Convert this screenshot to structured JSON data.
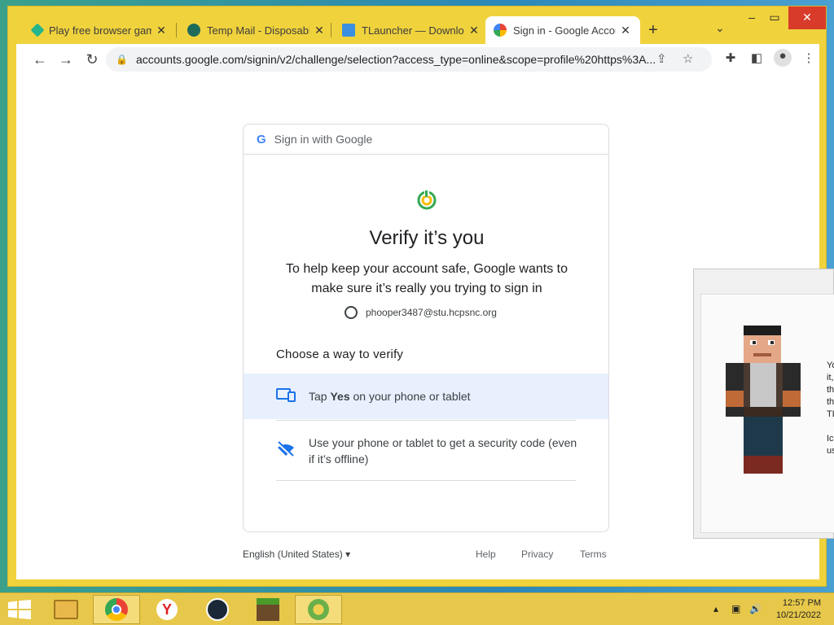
{
  "browser": {
    "tabs": [
      {
        "title": "Play free browser games",
        "favicon": "diamond-favicon",
        "color": "#23b58c"
      },
      {
        "title": "Temp Mail - Disposable",
        "favicon": "tempmail-favicon",
        "color": "#1f6b5a"
      },
      {
        "title": "TLauncher — Download",
        "favicon": "tlauncher-favicon",
        "color": "#3b8fe0"
      },
      {
        "title": "Sign in - Google Account",
        "favicon": "google-favicon",
        "color": "#4285f4"
      }
    ],
    "url": "accounts.google.com/signin/v2/challenge/selection?access_type=online&scope=profile%20https%3A..."
  },
  "page": {
    "header": "Sign in with Google",
    "title": "Verify it’s you",
    "subtitle": "To help keep your account safe, Google wants to make sure it’s really you trying to sign in",
    "account_email": "phooper3487@stu.hcpsnc.org",
    "choose_heading": "Choose a way to verify",
    "options": [
      {
        "prefix": "Tap ",
        "bold": "Yes",
        "suffix": " on your phone or tablet"
      },
      {
        "text": "Use your phone or tablet to get a security code (even if it’s offline)"
      }
    ],
    "footer": {
      "language": "English (United States)",
      "help": "Help",
      "privacy": "Privacy",
      "terms": "Terms"
    }
  },
  "side_window": {
    "text": "You\nit, y\nthe\nthe\nTLa\n\nIcon\nusin"
  },
  "taskbar": {
    "time": "12:57 PM",
    "date": "10/21/2022"
  },
  "colors": {
    "accent": "#1a73e8",
    "selected_bg": "#e8f0fe",
    "chrome_frame": "#f0d23c"
  }
}
